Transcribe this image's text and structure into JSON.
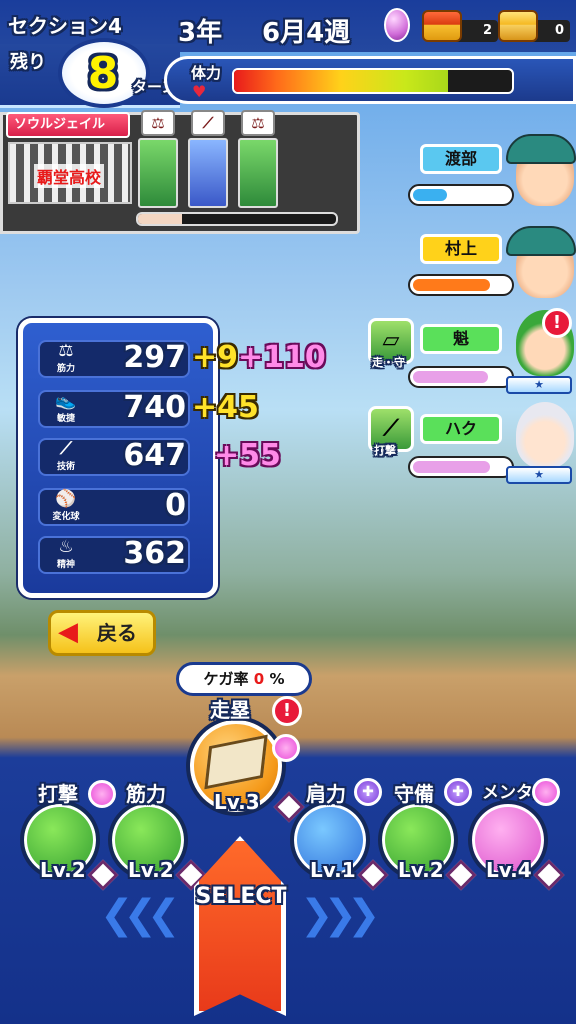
{
  "header": {
    "section": "セクション4",
    "year": "3年",
    "week": "6月4週",
    "remain_label": "残り",
    "turns": "8",
    "turn_label": "ターン",
    "stamina_label": "体力",
    "stamina_level": 0.77,
    "chest_red_count": "2",
    "chest_gold_count": "0"
  },
  "school": {
    "name": "ソウルジェイル",
    "logo_text": "覇堂高校",
    "progress": 0.22,
    "card_icons": [
      "dumbbell-icon",
      "bat-icon",
      "dumbbell-icon"
    ]
  },
  "stats": [
    {
      "label": "筋力",
      "icon": "dumbbell-icon",
      "value": "297",
      "bonus1": "+9",
      "bonus2": "+110"
    },
    {
      "label": "敏捷",
      "icon": "shoe-icon",
      "value": "740",
      "bonus1": "+45",
      "bonus2": ""
    },
    {
      "label": "技術",
      "icon": "bat-icon",
      "value": "647",
      "bonus1": "",
      "bonus2": "+55"
    },
    {
      "label": "変化球",
      "icon": "ball-icon",
      "value": "0",
      "bonus1": "",
      "bonus2": ""
    },
    {
      "label": "精神",
      "icon": "flame-icon",
      "value": "362",
      "bonus1": "",
      "bonus2": ""
    }
  ],
  "back_label": "戻る",
  "partners": [
    {
      "name": "渡部",
      "name_color": "#5ac8f0",
      "bar_color": "#3ab0f0",
      "level": 0.35
    },
    {
      "name": "村上",
      "name_color": "#ffd21a",
      "bar_color": "#ff7a1a",
      "level": 0.8
    },
    {
      "name": "魁",
      "name_color": "#5ae05a",
      "bar_color": "#e8a0e8",
      "level": 0.78,
      "type_label": "走・守"
    },
    {
      "name": "ハク",
      "name_color": "#5ae05a",
      "bar_color": "#e8a0e8",
      "level": 0.8,
      "type_label": "打撃"
    }
  ],
  "injury": {
    "label": "ケガ率",
    "value": "0",
    "unit": "%"
  },
  "practice": [
    {
      "label": "打撃",
      "level": "Lv.2"
    },
    {
      "label": "筋力",
      "level": "Lv.2"
    },
    {
      "label": "走塁",
      "level": "Lv.3"
    },
    {
      "label": "肩力",
      "level": "Lv.1"
    },
    {
      "label": "守備",
      "level": "Lv.2"
    },
    {
      "label": "メンタル",
      "level": "Lv.4"
    }
  ],
  "select_label": "SELECT"
}
